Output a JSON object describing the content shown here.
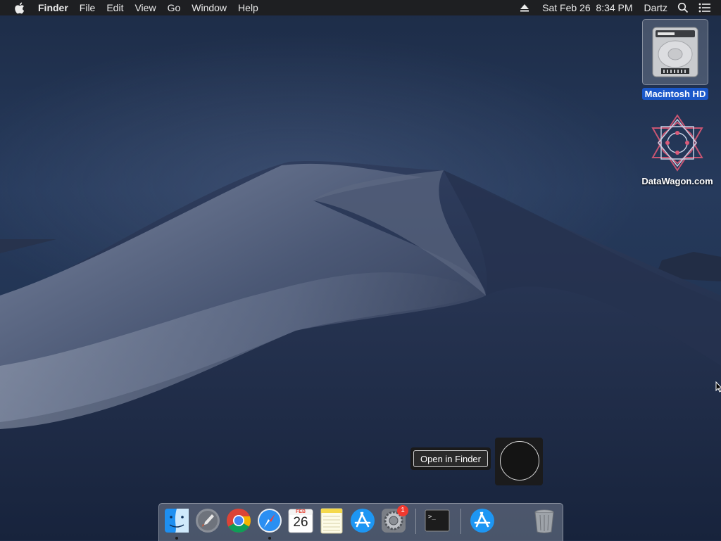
{
  "menubar": {
    "apple_icon": "apple-logo-icon",
    "app_name": "Finder",
    "menus": [
      "File",
      "Edit",
      "View",
      "Go",
      "Window",
      "Help"
    ],
    "clock": "Sat Feb 26  8:34 PM",
    "user": "Dartz",
    "icons": [
      "eject-icon",
      "spotlight-search-icon",
      "notification-center-icon"
    ]
  },
  "desktop": {
    "icons": [
      {
        "label": "Macintosh HD",
        "icon": "hard-drive-icon",
        "selected": true
      },
      {
        "label": "DataWagon.com",
        "icon": "datawagon-logo-icon",
        "selected": false
      }
    ]
  },
  "tooltip": {
    "text": "Open in Finder"
  },
  "dock": {
    "apps": [
      {
        "name": "Finder",
        "icon": "finder-icon",
        "running": true
      },
      {
        "name": "Launchpad",
        "icon": "launchpad-icon",
        "running": false
      },
      {
        "name": "Google Chrome",
        "icon": "chrome-icon",
        "running": false
      },
      {
        "name": "Safari",
        "icon": "safari-icon",
        "running": true
      },
      {
        "name": "Calendar",
        "icon": "calendar-icon",
        "running": false,
        "month": "FEB",
        "day": "26"
      },
      {
        "name": "Notes",
        "icon": "notes-icon",
        "running": false
      },
      {
        "name": "App Store",
        "icon": "app-store-icon",
        "running": false
      },
      {
        "name": "System Preferences",
        "icon": "system-preferences-icon",
        "running": false,
        "badge": "1"
      },
      {
        "name": "Terminal",
        "icon": "terminal-icon",
        "running": false
      },
      {
        "name": "App Store",
        "icon": "app-store-icon",
        "running": false
      },
      {
        "name": "Trash",
        "icon": "trash-icon",
        "running": false
      }
    ]
  },
  "colors": {
    "selection": "#1b58c9",
    "menubar": "#1e1f22",
    "badge": "#f0392f"
  }
}
